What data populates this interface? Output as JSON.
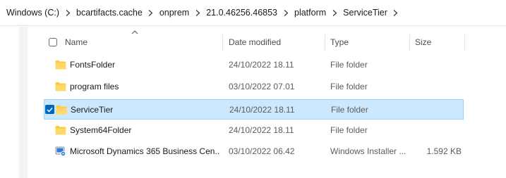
{
  "breadcrumb": {
    "items": [
      "Windows (C:)",
      "bcartifacts.cache",
      "onprem",
      "21.0.46256.46853",
      "platform",
      "ServiceTier"
    ]
  },
  "columns": {
    "name": "Name",
    "date_modified": "Date modified",
    "type": "Type",
    "size": "Size"
  },
  "rows": [
    {
      "name": "FontsFolder",
      "date": "24/10/2022 18.11",
      "type": "File folder",
      "size": "",
      "icon": "folder-icon",
      "selected": false
    },
    {
      "name": "program files",
      "date": "03/10/2022 07.01",
      "type": "File folder",
      "size": "",
      "icon": "folder-icon",
      "selected": false
    },
    {
      "name": "ServiceTier",
      "date": "24/10/2022 18.11",
      "type": "File folder",
      "size": "",
      "icon": "folder-icon",
      "selected": true
    },
    {
      "name": "System64Folder",
      "date": "24/10/2022 18.11",
      "type": "File folder",
      "size": "",
      "icon": "folder-icon",
      "selected": false
    },
    {
      "name": "Microsoft Dynamics 365 Business Cen...",
      "date": "03/10/2022 06.42",
      "type": "Windows Installer ...",
      "size": "1.592 KB",
      "icon": "installer-icon",
      "selected": false
    }
  ],
  "colors": {
    "selection_bg": "#cce8ff",
    "selection_border": "#99d1ff",
    "folder": "#ffc83d",
    "accent": "#0067c0"
  }
}
